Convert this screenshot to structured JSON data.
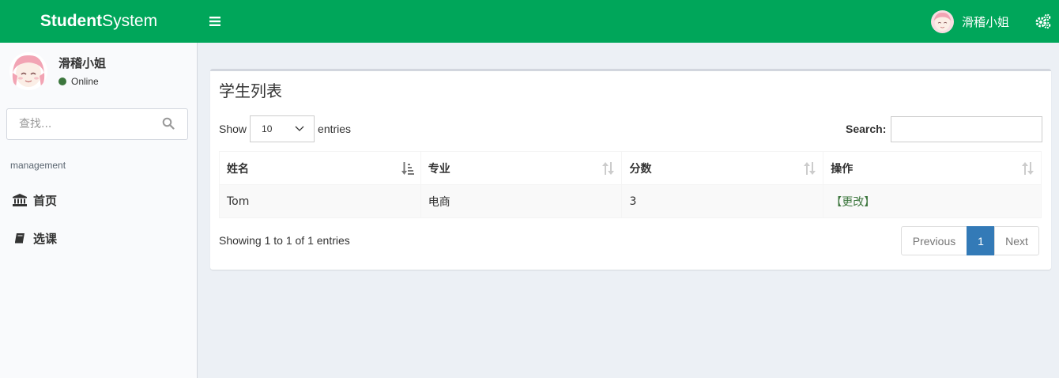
{
  "header": {
    "brand_bold": "Student",
    "brand_light": "System",
    "user_name": "滑稽小姐"
  },
  "sidebar": {
    "user_name": "滑稽小姐",
    "status": "Online",
    "search_placeholder": "查找...",
    "section_label": "management",
    "items": [
      {
        "label": "首页",
        "icon": "bank-icon"
      },
      {
        "label": "选课",
        "icon": "book-icon"
      }
    ]
  },
  "main": {
    "title": "学生列表",
    "show_label": "Show",
    "entries_label": "entries",
    "page_length": "10",
    "search_label": "Search:",
    "columns": [
      "姓名",
      "专业",
      "分数",
      "操作"
    ],
    "rows": [
      {
        "name": "Tom",
        "major": "电商",
        "score": "3",
        "action": "【更改】"
      }
    ],
    "info": "Showing 1 to 1 of 1 entries",
    "pagination": {
      "previous": "Previous",
      "current": "1",
      "next": "Next"
    }
  },
  "colors": {
    "header_bg": "#00a65a",
    "active_page": "#337ab7",
    "online_dot": "#3c763d",
    "edit_link": "#3c763d"
  }
}
